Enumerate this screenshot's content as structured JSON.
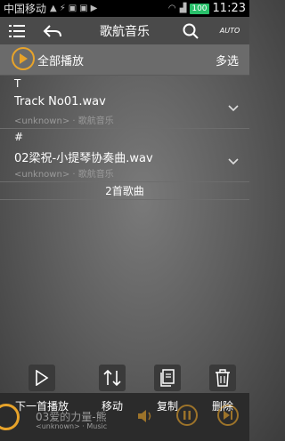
{
  "status_bar": {
    "carrier": "中国移动",
    "battery": "100",
    "time": "11:23"
  },
  "app_bar": {
    "title": "歌航音乐",
    "auto_label": "AUTO"
  },
  "toolbar": {
    "play_all_label": "全部播放",
    "multi_select_label": "多选"
  },
  "tracks": [
    {
      "section": "T",
      "title": "Track No01.wav",
      "artist": "<unknown>",
      "album": "歌航音乐"
    },
    {
      "section": "#",
      "title": "02梁祝-小提琴协奏曲.wav",
      "artist": "<unknown>",
      "album": "歌航音乐"
    }
  ],
  "song_count": "2首歌曲",
  "actions": [
    {
      "label": "下一首播放",
      "icon": "play-next-icon"
    },
    {
      "label": "移动",
      "icon": "move-icon"
    },
    {
      "label": "复制",
      "icon": "copy-icon"
    },
    {
      "label": "删除",
      "icon": "delete-icon"
    }
  ],
  "now_playing": {
    "title": "03爱的力量-熊",
    "subtitle": "<unknown> · Music"
  },
  "colors": {
    "accent": "#e7a32a",
    "battery": "#28c06a"
  }
}
